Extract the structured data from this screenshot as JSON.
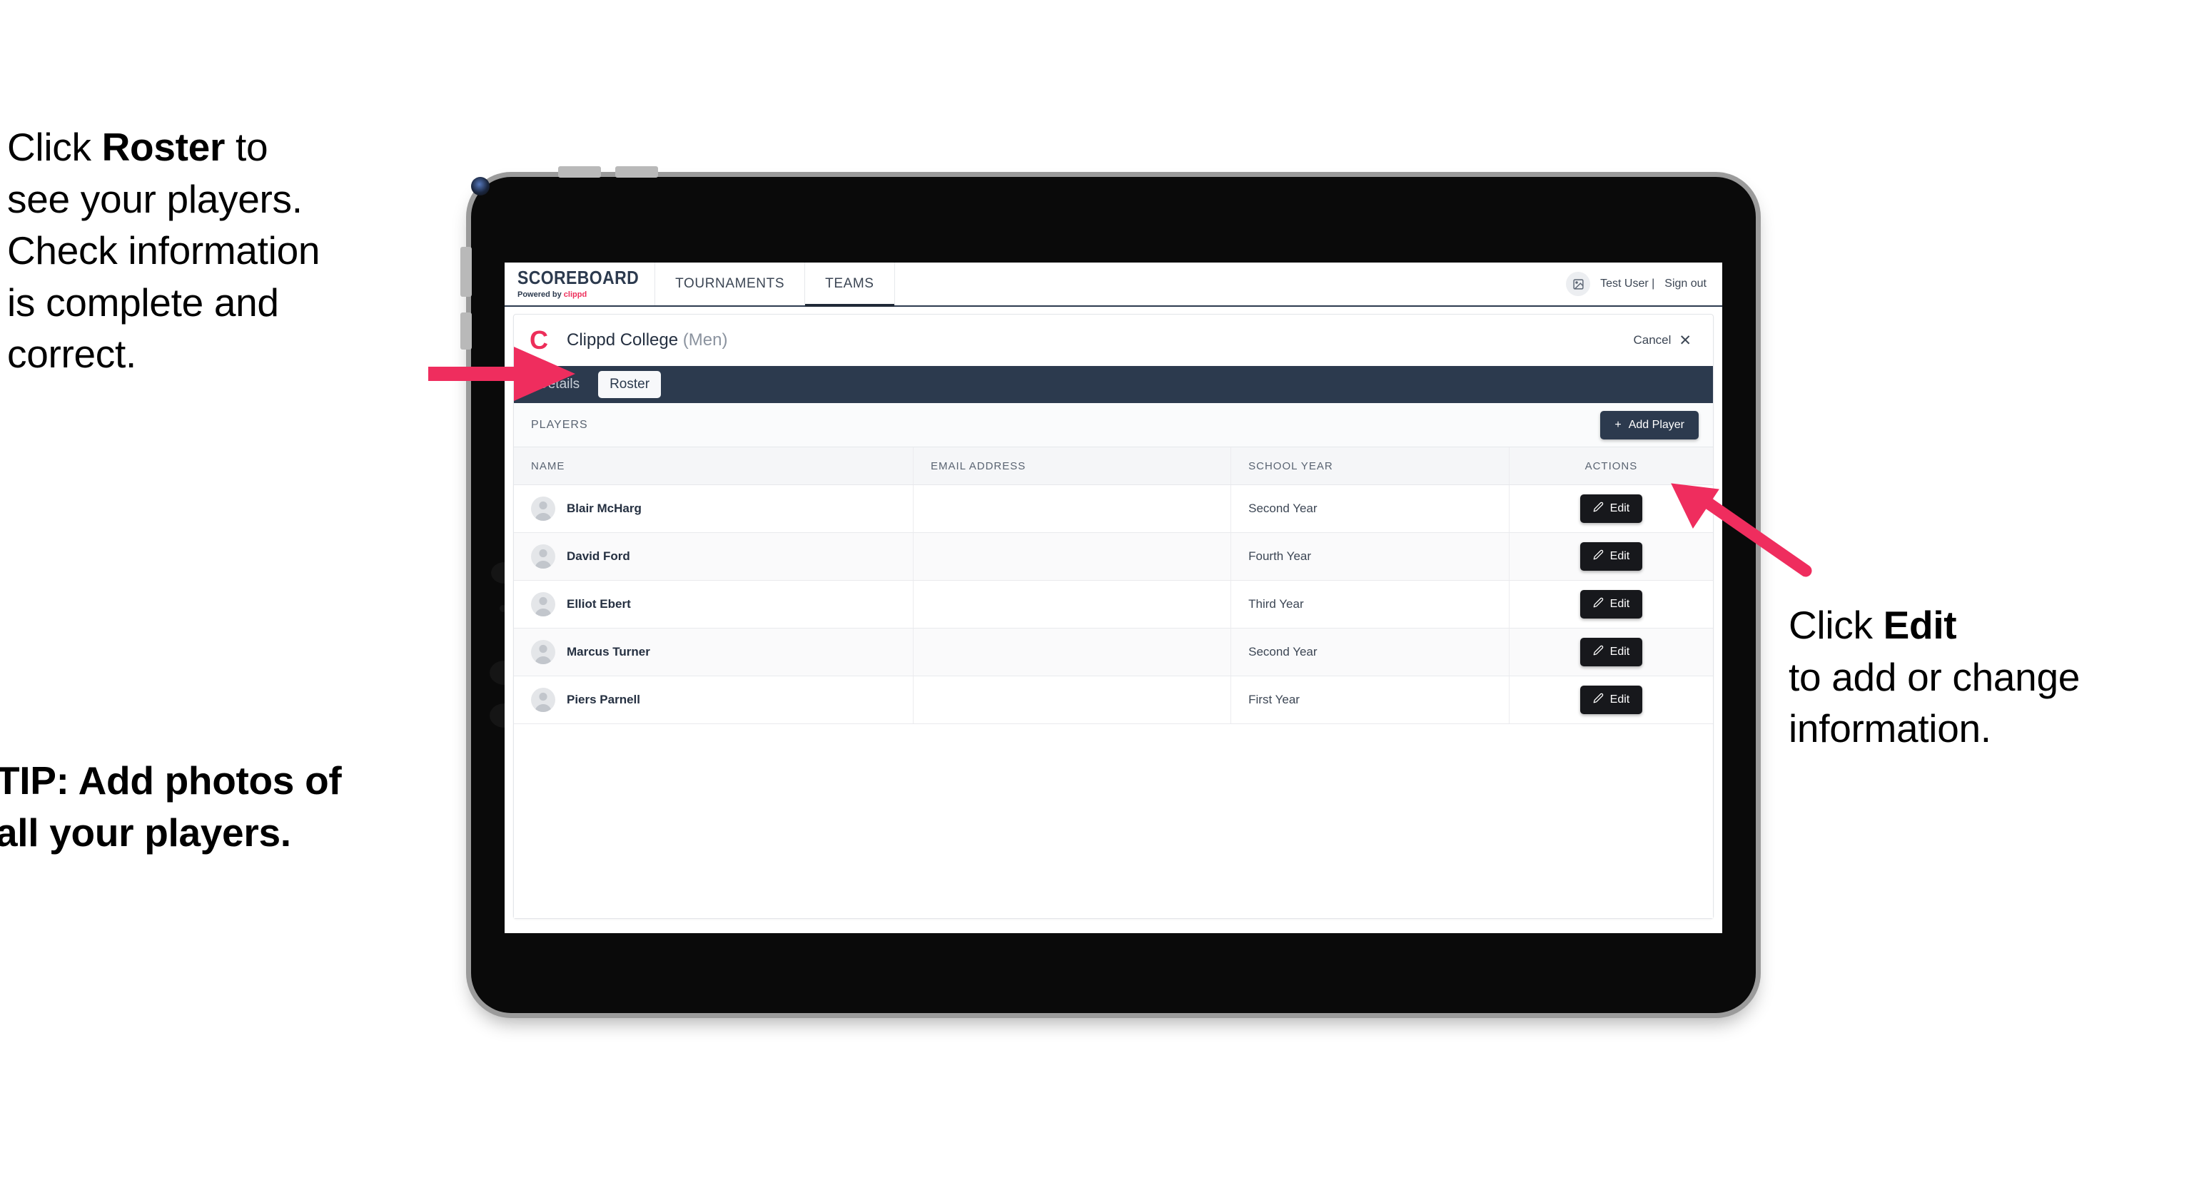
{
  "annotations": {
    "left_callout": {
      "prefix": "Click ",
      "bold": "Roster",
      "suffix": " to\nsee your players.\nCheck information\nis complete and\ncorrect."
    },
    "tip": "TIP: Add photos of\nall your players.",
    "right_callout": {
      "prefix": "Click ",
      "bold": "Edit",
      "suffix": "\nto add or change\ninformation."
    }
  },
  "colors": {
    "accent_pink": "#ed2e5a",
    "navy": "#2c3a4e",
    "edit_button": "#17181c",
    "arrow": "#ef2d5e"
  },
  "browser": {
    "topnav": {
      "brand_title": "SCOREBOARD",
      "brand_sub_prefix": "Powered by ",
      "brand_sub_accent": "clippd",
      "tabs": [
        {
          "label": "TOURNAMENTS",
          "active": false
        },
        {
          "label": "TEAMS",
          "active": true
        }
      ],
      "avatar_icon": "image-placeholder-icon",
      "user_name": "Test User |",
      "sign_out": "Sign out"
    },
    "card": {
      "team_logo_letter": "C",
      "team_name": "Clippd College",
      "team_gender": "(Men)",
      "cancel_label": "Cancel",
      "close_icon": "✕",
      "subtabs": [
        {
          "label": "Details",
          "active": false
        },
        {
          "label": "Roster",
          "active": true
        }
      ],
      "players_label": "PLAYERS",
      "add_player_label": "Add Player",
      "add_player_icon": "+",
      "table": {
        "columns": [
          "NAME",
          "EMAIL ADDRESS",
          "SCHOOL YEAR",
          "ACTIONS"
        ],
        "edit_label": "Edit",
        "edit_icon": "pencil-icon",
        "rows": [
          {
            "name": "Blair McHarg",
            "email": "",
            "school_year": "Second Year"
          },
          {
            "name": "David Ford",
            "email": "",
            "school_year": "Fourth Year"
          },
          {
            "name": "Elliot Ebert",
            "email": "",
            "school_year": "Third Year"
          },
          {
            "name": "Marcus Turner",
            "email": "",
            "school_year": "Second Year"
          },
          {
            "name": "Piers Parnell",
            "email": "",
            "school_year": "First Year"
          }
        ]
      }
    }
  }
}
